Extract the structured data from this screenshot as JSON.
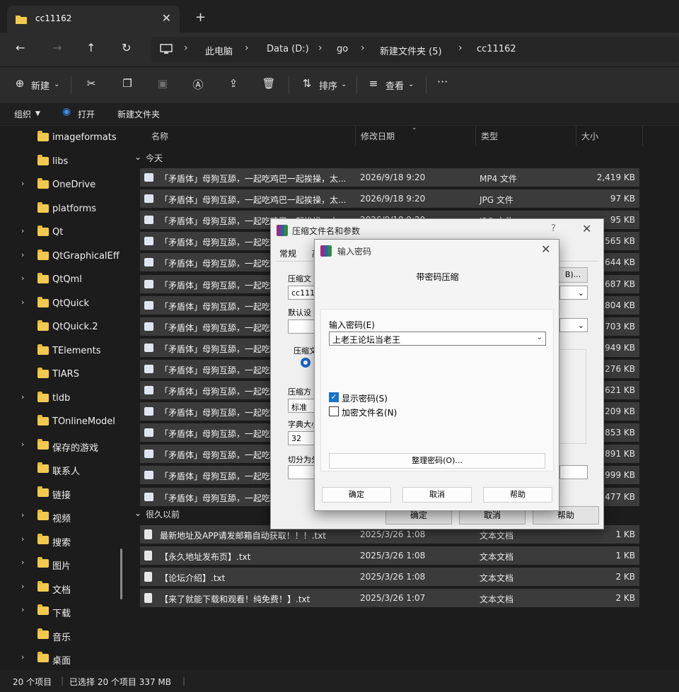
{
  "window": {
    "tab_title": "cc11162",
    "new_tab": "+",
    "close_tab": "✕"
  },
  "address": {
    "root": "此电脑",
    "crumbs": [
      "Data (D:)",
      "go",
      "新建文件夹 (5)",
      "cc11162"
    ]
  },
  "toolbar": {
    "new_label": "新建",
    "sort_label": "排序",
    "view_label": "查看",
    "more": "···"
  },
  "subbar": {
    "organize": "组织",
    "open": "打开",
    "new_folder": "新建文件夹"
  },
  "sidebar": {
    "items": [
      {
        "label": "imageformats",
        "chev": false
      },
      {
        "label": "libs",
        "chev": false
      },
      {
        "label": "OneDrive",
        "chev": true
      },
      {
        "label": "platforms",
        "chev": false
      },
      {
        "label": "Qt",
        "chev": true
      },
      {
        "label": "QtGraphicalEff",
        "chev": true
      },
      {
        "label": "QtQml",
        "chev": true
      },
      {
        "label": "QtQuick",
        "chev": true
      },
      {
        "label": "QtQuick.2",
        "chev": false
      },
      {
        "label": "TElements",
        "chev": false
      },
      {
        "label": "TIARS",
        "chev": false
      },
      {
        "label": "tldb",
        "chev": true
      },
      {
        "label": "TOnlineModel",
        "chev": false
      },
      {
        "label": "保存的游戏",
        "chev": true
      },
      {
        "label": "联系人",
        "chev": false
      },
      {
        "label": "链接",
        "chev": false
      },
      {
        "label": "视频",
        "chev": true
      },
      {
        "label": "搜索",
        "chev": true
      },
      {
        "label": "图片",
        "chev": true
      },
      {
        "label": "文档",
        "chev": true
      },
      {
        "label": "下载",
        "chev": true
      },
      {
        "label": "音乐",
        "chev": false
      },
      {
        "label": "桌面",
        "chev": true
      }
    ]
  },
  "columns": {
    "name": "名称",
    "date": "修改日期",
    "type": "类型",
    "size": "大小"
  },
  "groups": {
    "today": "今天",
    "long_ago": "很久以前"
  },
  "files_today": [
    {
      "name": "「矛盾体」母狗互舔，一起吃鸡巴一起挨操，太...",
      "date": "2026/9/18 9:20",
      "type": "MP4 文件",
      "size": "2,419 KB"
    },
    {
      "name": "「矛盾体」母狗互舔，一起吃鸡巴一起挨操，太...",
      "date": "2026/9/18 9:20",
      "type": "JPG 文件",
      "size": "97 KB"
    },
    {
      "name": "「矛盾体」母狗互舔，一起吃鸡巴一起挨操，太...",
      "date": "2026/9/18 9:20",
      "type": "JPG 文件",
      "size": "95 KB"
    },
    {
      "name": "「矛盾体」母狗互舔，一起吃",
      "date": "",
      "type": "",
      "size": "565 KB"
    },
    {
      "name": "「矛盾体」母狗互舔，一起吃",
      "date": "",
      "type": "",
      "size": "644 KB"
    },
    {
      "name": "「矛盾体」母狗互舔，一起吃",
      "date": "",
      "type": "",
      "size": "687 KB"
    },
    {
      "name": "「矛盾体」母狗互舔，一起吃",
      "date": "",
      "type": "",
      "size": "804 KB"
    },
    {
      "name": "「矛盾体」母狗互舔，一起吃",
      "date": "",
      "type": "",
      "size": "703 KB"
    },
    {
      "name": "「矛盾体」母狗互舔，一起吃",
      "date": "",
      "type": "",
      "size": "949 KB"
    },
    {
      "name": "「矛盾体」母狗互舔，一起吃",
      "date": "",
      "type": "",
      "size": "276 KB"
    },
    {
      "name": "「矛盾体」母狗互舔，一起吃",
      "date": "",
      "type": "",
      "size": "621 KB"
    },
    {
      "name": "「矛盾体」母狗互舔，一起吃",
      "date": "",
      "type": "",
      "size": "209 KB"
    },
    {
      "name": "「矛盾体」母狗互舔，一起吃",
      "date": "",
      "type": "",
      "size": "853 KB"
    },
    {
      "name": "「矛盾体」母狗互舔，一起吃",
      "date": "",
      "type": "",
      "size": "891 KB"
    },
    {
      "name": "「矛盾体」母狗互舔，一起吃",
      "date": "",
      "type": "",
      "size": "999 KB"
    },
    {
      "name": "「矛盾体」母狗互舔，一起吃",
      "date": "",
      "type": "",
      "size": "477 KB"
    }
  ],
  "files_old": [
    {
      "name": "最新地址及APP请发邮箱自动获取！！！.txt",
      "date": "2025/3/26 1:08",
      "type": "文本文档",
      "size": "1 KB"
    },
    {
      "name": "【永久地址发布页】.txt",
      "date": "2025/3/26 1:08",
      "type": "文本文档",
      "size": "1 KB"
    },
    {
      "name": "【论坛介绍】.txt",
      "date": "2025/3/26 1:08",
      "type": "文本文档",
      "size": "2 KB"
    },
    {
      "name": "【来了就能下载和观看！纯免费！】.txt",
      "date": "2025/3/26 1:07",
      "type": "文本文档",
      "size": "2 KB"
    }
  ],
  "status": {
    "count": "20 个项目",
    "selected": "已选择 20 个项目 337 MB"
  },
  "dialog_compress": {
    "title": "压缩文件名和参数",
    "help": "?",
    "tab_general": "常规",
    "tab_second": "高",
    "archive_label": "压缩文",
    "archive_value": "cc1116",
    "browse_suffix": "B)...",
    "default_label": "默认设",
    "format_label": "压缩文",
    "method_label": "压缩方",
    "method_value": "标准",
    "dict_label": "字典大小",
    "dict_value": "32",
    "split_label": "切分为分",
    "ok": "确定",
    "cancel": "取消",
    "help_btn": "帮助"
  },
  "dialog_password": {
    "title": "输入密码",
    "subtitle": "带密码压缩",
    "field_label": "输入密码(E)",
    "field_value": "上老王论坛当老王",
    "show_password": "显示密码(S)",
    "encrypt_names": "加密文件名(N)",
    "organize": "整理密码(O)...",
    "ok": "确定",
    "cancel": "取消",
    "help": "帮助"
  }
}
